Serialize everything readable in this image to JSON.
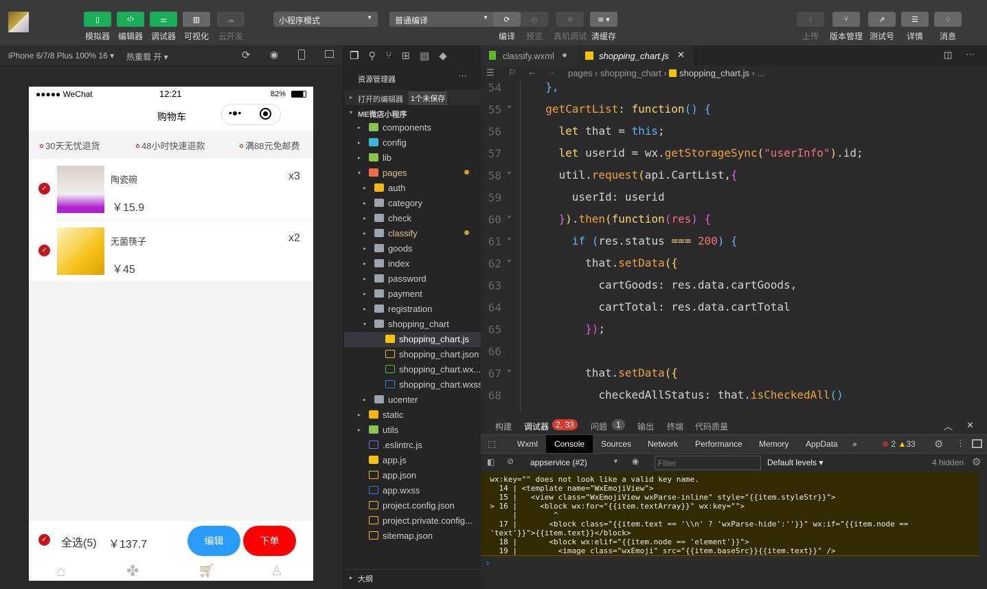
{
  "toolbar": {
    "left_buttons": [
      {
        "label": "模拟器",
        "icon": "phone-icon"
      },
      {
        "label": "编辑器",
        "icon": "code-icon"
      },
      {
        "label": "调试器",
        "icon": "debug-icon"
      },
      {
        "label": "可视化",
        "icon": "layout-icon"
      },
      {
        "label": "云开发",
        "icon": "cloud-icon"
      }
    ],
    "mode_select": "小程序模式",
    "compile_select": "普通编译",
    "mid_buttons": [
      {
        "label": "编译",
        "icon": "refresh-icon"
      },
      {
        "label": "预览",
        "icon": "eye-icon"
      },
      {
        "label": "真机调试",
        "icon": "bug-icon"
      },
      {
        "label": "清缓存",
        "icon": "layers-icon"
      }
    ],
    "right_buttons": [
      {
        "label": "上传",
        "icon": "upload-icon"
      },
      {
        "label": "版本管理",
        "icon": "branch-icon"
      },
      {
        "label": "测试号",
        "icon": "external-icon"
      },
      {
        "label": "详情",
        "icon": "menu-icon"
      },
      {
        "label": "消息",
        "icon": "bell-icon"
      }
    ]
  },
  "simulator": {
    "device": "iPhone 6/7/8 Plus 100% 16 ▾",
    "hot_reload": "热重载 开 ▾"
  },
  "phone": {
    "carrier": "●●●●● WeChat",
    "time": "12:21",
    "battery": "82%",
    "title": "购物车",
    "tags": [
      "30天无忧退货",
      "48小时快速退款",
      "满88元免邮费"
    ],
    "items": [
      {
        "name": "陶瓷碗",
        "price": "￥15.9",
        "qty": "x3"
      },
      {
        "name": "无菌筷子",
        "price": "￥45",
        "qty": "x2"
      }
    ],
    "select_all": "全选(5)",
    "total": "￥137.7",
    "edit_button": "编辑",
    "order_button": "下单"
  },
  "explorer": {
    "title": "资源管理器",
    "open_editors": "打开的编辑器",
    "unsaved": "1个未保存",
    "project": "ME微店小程序",
    "outline": "大纲",
    "tree": [
      {
        "name": "components",
        "lvl": 0,
        "type": "folder-g",
        "arrow": "▸"
      },
      {
        "name": "config",
        "lvl": 0,
        "type": "folder-b",
        "arrow": "▸"
      },
      {
        "name": "lib",
        "lvl": 0,
        "type": "folder-g",
        "arrow": "▸"
      },
      {
        "name": "pages",
        "lvl": 0,
        "type": "folder-r",
        "arrow": "▾",
        "mod": true
      },
      {
        "name": "auth",
        "lvl": 1,
        "type": "folder-y",
        "arrow": "▸"
      },
      {
        "name": "category",
        "lvl": 1,
        "type": "folder",
        "arrow": "▸"
      },
      {
        "name": "check",
        "lvl": 1,
        "type": "folder",
        "arrow": "▸"
      },
      {
        "name": "classify",
        "lvl": 1,
        "type": "folder",
        "arrow": "▸",
        "mod": true
      },
      {
        "name": "goods",
        "lvl": 1,
        "type": "folder",
        "arrow": "▸"
      },
      {
        "name": "index",
        "lvl": 1,
        "type": "folder",
        "arrow": "▸"
      },
      {
        "name": "password",
        "lvl": 1,
        "type": "folder",
        "arrow": "▸"
      },
      {
        "name": "payment",
        "lvl": 1,
        "type": "folder",
        "arrow": "▸"
      },
      {
        "name": "registration",
        "lvl": 1,
        "type": "folder",
        "arrow": "▸"
      },
      {
        "name": "shopping_chart",
        "lvl": 1,
        "type": "folder",
        "arrow": "▾"
      },
      {
        "name": "shopping_chart.js",
        "lvl": 2,
        "type": "js",
        "active": true
      },
      {
        "name": "shopping_chart.json",
        "lvl": 2,
        "type": "json"
      },
      {
        "name": "shopping_chart.wx...",
        "lvl": 2,
        "type": "wxml"
      },
      {
        "name": "shopping_chart.wxss",
        "lvl": 2,
        "type": "wxss"
      },
      {
        "name": "ucenter",
        "lvl": 1,
        "type": "folder",
        "arrow": "▸"
      },
      {
        "name": "static",
        "lvl": 0,
        "type": "folder-y",
        "arrow": "▸"
      },
      {
        "name": "utils",
        "lvl": 0,
        "type": "folder-g",
        "arrow": "▸"
      },
      {
        "name": ".eslintrc.js",
        "lvl": 0,
        "type": "eslint"
      },
      {
        "name": "app.js",
        "lvl": 0,
        "type": "js"
      },
      {
        "name": "app.json",
        "lvl": 0,
        "type": "json"
      },
      {
        "name": "app.wxss",
        "lvl": 0,
        "type": "wxss"
      },
      {
        "name": "project.config.json",
        "lvl": 0,
        "type": "json"
      },
      {
        "name": "project.private.config...",
        "lvl": 0,
        "type": "json"
      },
      {
        "name": "sitemap.json",
        "lvl": 0,
        "type": "json"
      }
    ]
  },
  "editor": {
    "tabs": [
      {
        "label": "classify.wxml",
        "modified": true
      },
      {
        "label": "shopping_chart.js",
        "active": true
      }
    ],
    "breadcrumb": [
      "pages",
      "shopping_chart",
      "shopping_chart.js",
      "..."
    ],
    "lines": [
      {
        "n": "54",
        "t": [
          [
            "  ",
            "w"
          ],
          [
            "},",
            "b"
          ]
        ]
      },
      {
        "n": "55",
        "f": true,
        "t": [
          [
            "  ",
            "w"
          ],
          [
            "getCartList",
            "o"
          ],
          [
            ": ",
            "w"
          ],
          [
            "function",
            "y"
          ],
          [
            "() {",
            "b"
          ]
        ]
      },
      {
        "n": "56",
        "t": [
          [
            "    ",
            "w"
          ],
          [
            "let",
            "y"
          ],
          [
            " that = ",
            "w"
          ],
          [
            "this",
            "b"
          ],
          [
            ";",
            "w"
          ]
        ]
      },
      {
        "n": "57",
        "t": [
          [
            "    ",
            "w"
          ],
          [
            "let",
            "y"
          ],
          [
            " userid = wx.",
            "w"
          ],
          [
            "getStorageSync",
            "o"
          ],
          [
            "(",
            "y"
          ],
          [
            "\"userInfo\"",
            "s"
          ],
          [
            ")",
            "y"
          ],
          [
            ".id;",
            "w"
          ]
        ]
      },
      {
        "n": "58",
        "f": true,
        "t": [
          [
            "    util.",
            "w"
          ],
          [
            "request",
            "o"
          ],
          [
            "(",
            "y"
          ],
          [
            "api.CartList,",
            "w"
          ],
          [
            "{",
            "m"
          ]
        ]
      },
      {
        "n": "59",
        "t": [
          [
            "      userId: userid",
            "w"
          ]
        ]
      },
      {
        "n": "60",
        "f": true,
        "t": [
          [
            "    ",
            "w"
          ],
          [
            "}",
            "m"
          ],
          [
            ")",
            "y"
          ],
          [
            ".",
            "w"
          ],
          [
            "then",
            "o"
          ],
          [
            "(",
            "y"
          ],
          [
            "function",
            "y"
          ],
          [
            "(",
            "m"
          ],
          [
            "res",
            "s"
          ],
          [
            ") ",
            "m"
          ],
          [
            "{",
            "m"
          ]
        ]
      },
      {
        "n": "61",
        "f": true,
        "t": [
          [
            "      ",
            "w"
          ],
          [
            "if",
            "b"
          ],
          [
            " (",
            "b"
          ],
          [
            "res.status ",
            "w"
          ],
          [
            "===",
            "y"
          ],
          [
            " ",
            "w"
          ],
          [
            "200",
            "s"
          ],
          [
            ") {",
            "b"
          ]
        ]
      },
      {
        "n": "62",
        "f": true,
        "t": [
          [
            "        that.",
            "w"
          ],
          [
            "setData",
            "o"
          ],
          [
            "({",
            "y"
          ]
        ]
      },
      {
        "n": "63",
        "t": [
          [
            "          cartGoods: res.data.cartGoods,",
            "w"
          ]
        ]
      },
      {
        "n": "64",
        "t": [
          [
            "          cartTotal: res.data.cartTotal",
            "w"
          ]
        ]
      },
      {
        "n": "65",
        "t": [
          [
            "        ",
            "w"
          ],
          [
            "})",
            "m"
          ],
          [
            ";",
            "w"
          ]
        ]
      },
      {
        "n": "66",
        "t": []
      },
      {
        "n": "67",
        "f": true,
        "t": [
          [
            "        that.",
            "w"
          ],
          [
            "setData",
            "o"
          ],
          [
            "({",
            "y"
          ]
        ]
      },
      {
        "n": "68",
        "t": [
          [
            "          checkedAllStatus: that.",
            "w"
          ],
          [
            "isCheckedAll",
            "o"
          ],
          [
            "()",
            "b"
          ]
        ]
      }
    ]
  },
  "panel": {
    "tabs": [
      "构建",
      "调试器",
      "问题",
      "输出",
      "终端",
      "代码质量"
    ],
    "debugger_badge": "2, 33",
    "problems_badge": "1",
    "devtools_tabs": [
      "Wxml",
      "Console",
      "Sources",
      "Network",
      "Performance",
      "Memory",
      "AppData",
      "»"
    ],
    "errors": "2",
    "warnings": "33",
    "context": "appservice (#2)",
    "filter_placeholder": "Filter",
    "levels": "Default levels ▾",
    "hidden": "4 hidden",
    "console_lines": [
      "  wx:key=\"\" does not look like a valid key name.",
      "    14 | <template name=\"WxEmojiView\">",
      "    15 |   <view class=\"WxEmojiView wxParse-inline\" style=\"{{item.styleStr}}\">",
      "  > 16 |     <block wx:for=\"{{item.textArray}}\" wx:key=\"\">",
      "       |        ^",
      "    17 |       <block class=\"{{item.text == '\\\\n' ? 'wxParse-hide':''}}\" wx:if=\"{{item.node ==",
      "  'text'}}\">{{item.text}}</block>",
      "    18 |       <block wx:elif=\"{{item.node == 'element'}}\">",
      "    19 |         <image class=\"wxEmoji\" src=\"{{item.baseSrc}}{{item.text}}\" />"
    ],
    "prompt": "›"
  },
  "colors": {
    "accent_green": "#1aad5a",
    "check_red": "#c3161c",
    "edit_blue": "#2a9bff",
    "order_red": "#ff0000",
    "warning_bg": "#332b00"
  }
}
